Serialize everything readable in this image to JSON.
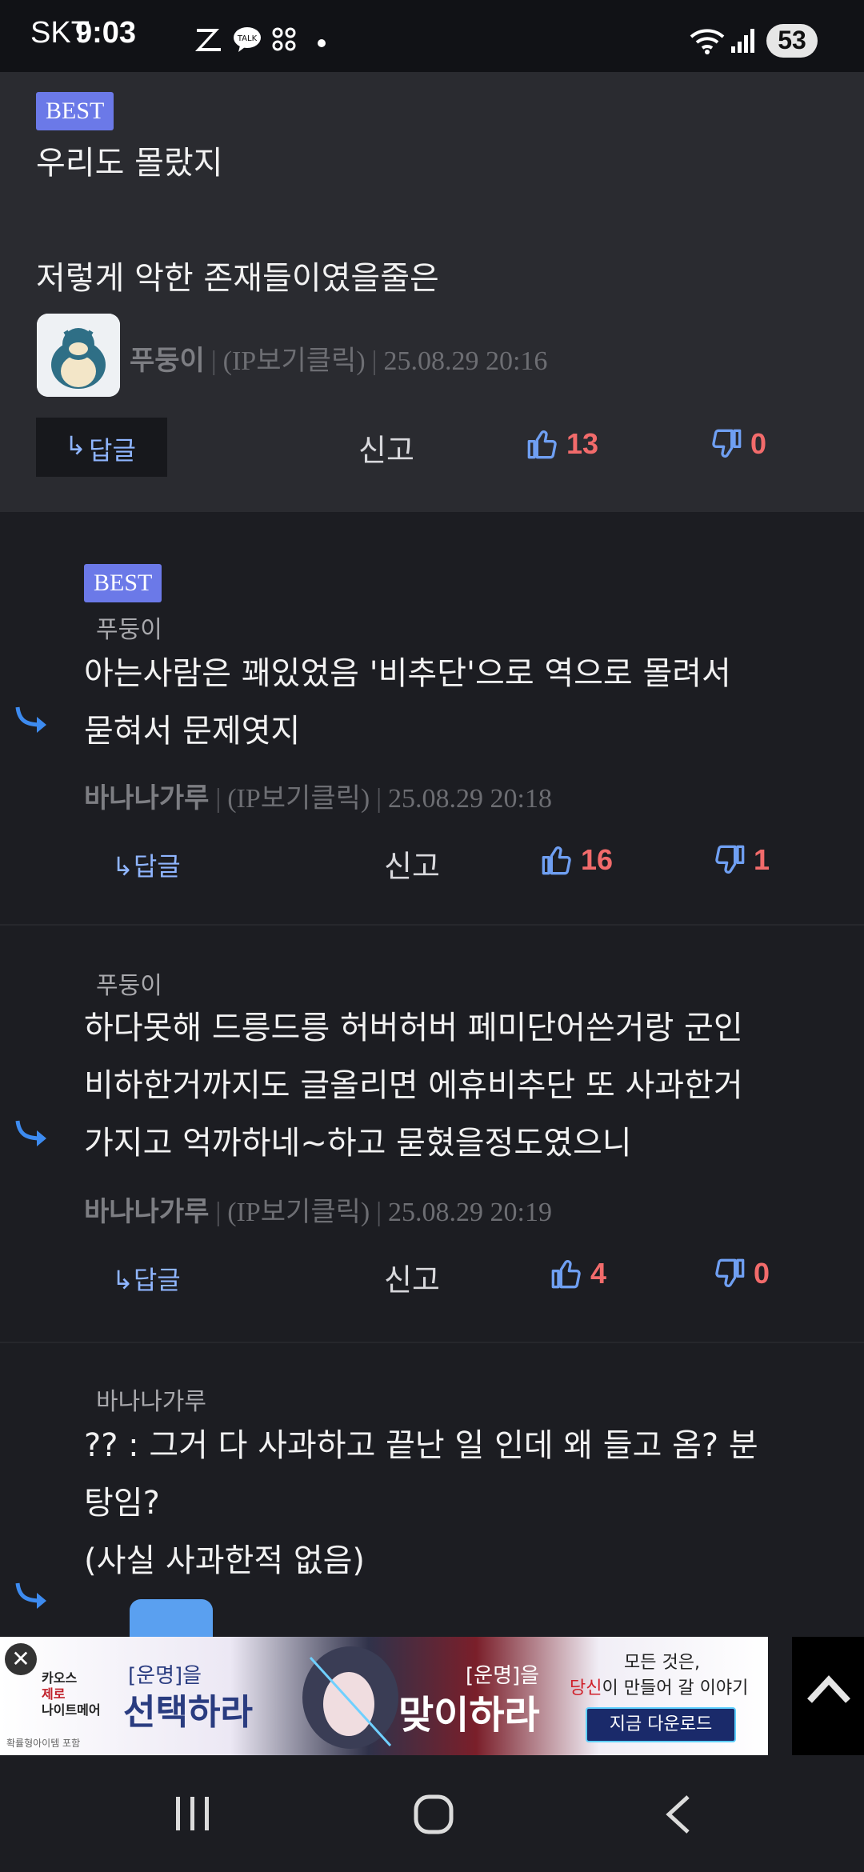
{
  "status_bar": {
    "carrier": "SKT",
    "time": "9:03",
    "battery": "53",
    "app_icons": [
      "zepeto-z-icon",
      "kakaotalk-icon",
      "app-grid-icon",
      "dot-icon"
    ]
  },
  "comments": [
    {
      "best_badge": "BEST",
      "parent_name": "",
      "lines": [
        "우리도 몰랐지",
        "",
        "저렇게 악한 존재들이였을줄은"
      ],
      "nickname": "푸둥이",
      "ip": "(IP보기클릭)",
      "date": "25.08.29 20:16",
      "reply_label": "답글",
      "report_label": "신고",
      "likes": "13",
      "dislikes": "0"
    },
    {
      "best_badge": "BEST",
      "parent_name": "푸둥이",
      "lines": [
        "아는사람은 꽤있었음 '비추단'으로 역으로 몰려서",
        "묻혀서 문제엿지"
      ],
      "nickname": "바나나가루",
      "ip": "(IP보기클릭)",
      "date": "25.08.29 20:18",
      "reply_label": "답글",
      "report_label": "신고",
      "likes": "16",
      "dislikes": "1"
    },
    {
      "best_badge": "",
      "parent_name": "푸둥이",
      "lines": [
        "하다못해 드릉드릉 허버허버 페미단어쓴거랑 군인",
        "비하한거까지도 글올리면 에휴비추단 또 사과한거",
        "가지고 억까하네~하고 묻혔을정도였으니"
      ],
      "nickname": "바나나가루",
      "ip": "(IP보기클릭)",
      "date": "25.08.29 20:19",
      "reply_label": "답글",
      "report_label": "신고",
      "likes": "4",
      "dislikes": "0"
    },
    {
      "best_badge": "",
      "parent_name": "바나나가루",
      "lines": [
        "?? : 그거 다 사과하고 끝난 일 인데 왜 들고 옴? 분",
        "탕임?",
        "(사실 사과한적 없음)"
      ],
      "nickname": "",
      "ip": "",
      "date": ""
    }
  ],
  "ad": {
    "brand_line1": "카오스",
    "brand_line2": "제로",
    "brand_line3": "나이트메어",
    "tagline_left_small": "[운명]을",
    "tagline_left_big": "선택하라",
    "tagline_mid_small": "[운명]을",
    "tagline_mid_big": "맞이하라",
    "right_line1": "모든 것은,",
    "right_line2_highlight": "당신",
    "right_line2_rest": "이 만들어 갈 이야기",
    "download_label": "지금 다운로드",
    "footnote": "확률형아이템 포함"
  },
  "colors": {
    "background": "#1c1d22",
    "best_badge": "#6b79e8",
    "vote_count": "#f26b6b",
    "reply_link": "#8fb5ff"
  }
}
